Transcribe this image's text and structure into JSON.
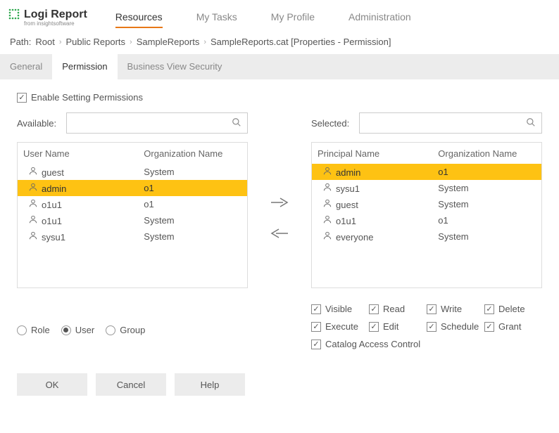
{
  "logo": {
    "brand": "Logi Report",
    "sub": "from insightsoftware"
  },
  "nav": {
    "items": [
      "Resources",
      "My Tasks",
      "My Profile",
      "Administration"
    ],
    "active": 0
  },
  "breadcrumb": {
    "prefix": "Path:",
    "parts": [
      "Root",
      "Public Reports",
      "SampleReports",
      "SampleReports.cat [Properties - Permission]"
    ]
  },
  "tabs": {
    "items": [
      "General",
      "Permission",
      "Business View Security"
    ],
    "active": 1
  },
  "enable_label": "Enable Setting Permissions",
  "enable_checked": true,
  "available": {
    "label": "Available:",
    "col_name": "User Name",
    "col_org": "Organization Name",
    "rows": [
      {
        "name": "guest",
        "org": "System",
        "selected": false
      },
      {
        "name": "admin",
        "org": "o1",
        "selected": true
      },
      {
        "name": "o1u1",
        "org": "o1",
        "selected": false
      },
      {
        "name": "o1u1",
        "org": "System",
        "selected": false
      },
      {
        "name": "sysu1",
        "org": "System",
        "selected": false
      }
    ]
  },
  "selected_list": {
    "label": "Selected:",
    "col_name": "Principal Name",
    "col_org": "Organization Name",
    "rows": [
      {
        "name": "admin",
        "org": "o1",
        "selected": true
      },
      {
        "name": "sysu1",
        "org": "System",
        "selected": false
      },
      {
        "name": "guest",
        "org": "System",
        "selected": false
      },
      {
        "name": "o1u1",
        "org": "o1",
        "selected": false
      },
      {
        "name": "everyone",
        "org": "System",
        "selected": false
      }
    ]
  },
  "principal_type": {
    "options": [
      "Role",
      "User",
      "Group"
    ],
    "selected": 1
  },
  "permissions": {
    "items": [
      {
        "label": "Visible",
        "checked": true
      },
      {
        "label": "Read",
        "checked": true
      },
      {
        "label": "Write",
        "checked": true
      },
      {
        "label": "Delete",
        "checked": true
      },
      {
        "label": "Execute",
        "checked": true
      },
      {
        "label": "Edit",
        "checked": true
      },
      {
        "label": "Schedule",
        "checked": true
      },
      {
        "label": "Grant",
        "checked": true
      }
    ],
    "catalog": {
      "label": "Catalog Access Control",
      "checked": true
    }
  },
  "buttons": {
    "ok": "OK",
    "cancel": "Cancel",
    "help": "Help"
  }
}
